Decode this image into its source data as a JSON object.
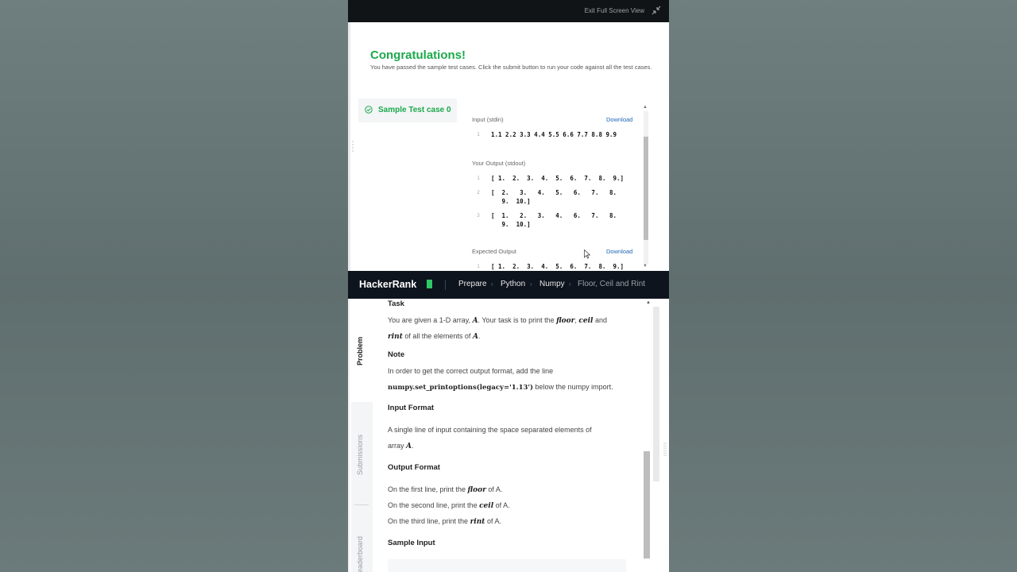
{
  "topbar": {
    "exit_label": "Exit Full Screen View"
  },
  "result": {
    "title": "Congratulations!",
    "message": "You have passed the sample test cases. Click the submit button to run your code against all the test cases.",
    "test_case_tab": "Sample Test case 0",
    "input_label": "Input (stdin)",
    "download_label": "Download",
    "input_lines": [
      {
        "num": "1",
        "text": "1.1 2.2 3.3 4.4 5.5 6.6 7.7 8.8 9.9"
      }
    ],
    "output_label": "Your Output (stdout)",
    "output_lines": [
      {
        "num": "1",
        "text": "[ 1.  2.  3.  4.  5.  6.  7.  8.  9.]"
      },
      {
        "num": "2",
        "text": "[  2.   3.   4.   5.   6.   7.   8.\n   9.  10.]"
      },
      {
        "num": "3",
        "text": "[  1.   2.   3.   4.   6.   7.   8.\n   9.  10.]"
      }
    ],
    "expected_label": "Expected Output",
    "expected_lines": [
      {
        "num": "1",
        "text": "[ 1.  2.  3.  4.  5.  6.  7.  8.  9.]"
      }
    ]
  },
  "navbar": {
    "logo": "HackerRank",
    "crumbs": [
      "Prepare",
      "Python",
      "Numpy",
      "Floor, Ceil and Rint"
    ]
  },
  "sidebar": {
    "tabs": [
      "Problem",
      "Submissions",
      "Leaderboard"
    ]
  },
  "problem": {
    "task_heading": "Task",
    "task_line1_a": "You are given a 1-D array, ",
    "task_var_a": "A",
    "task_line1_b": ". Your task is to print the ",
    "task_floor": "floor",
    "task_comma": ", ",
    "task_ceil": "ceil",
    "task_and": " and",
    "task_rint": "rint",
    "task_line2_b": " of all the elements of ",
    "task_var_a2": "A",
    "task_period": ".",
    "note_heading": "Note",
    "note_line1": "In order to get the correct output format, add the line",
    "note_code": "numpy.set_printoptions(legacy='1.13')",
    "note_line2_b": " below the numpy import.",
    "input_heading": "Input Format",
    "input_line1": "A single line of input containing the space separated elements of",
    "input_line2_a": "array ",
    "input_var": "A",
    "input_period": ".",
    "output_heading": "Output Format",
    "out1_a": "On the first line, print the ",
    "out1_m": "floor",
    "out1_b": " of A.",
    "out2_a": "On the second line, print the ",
    "out2_m": "ceil",
    "out2_b": " of A.",
    "out3_a": "On the third line, print the ",
    "out3_m": "rint",
    "out3_b": " of A.",
    "sample_heading": "Sample Input"
  }
}
